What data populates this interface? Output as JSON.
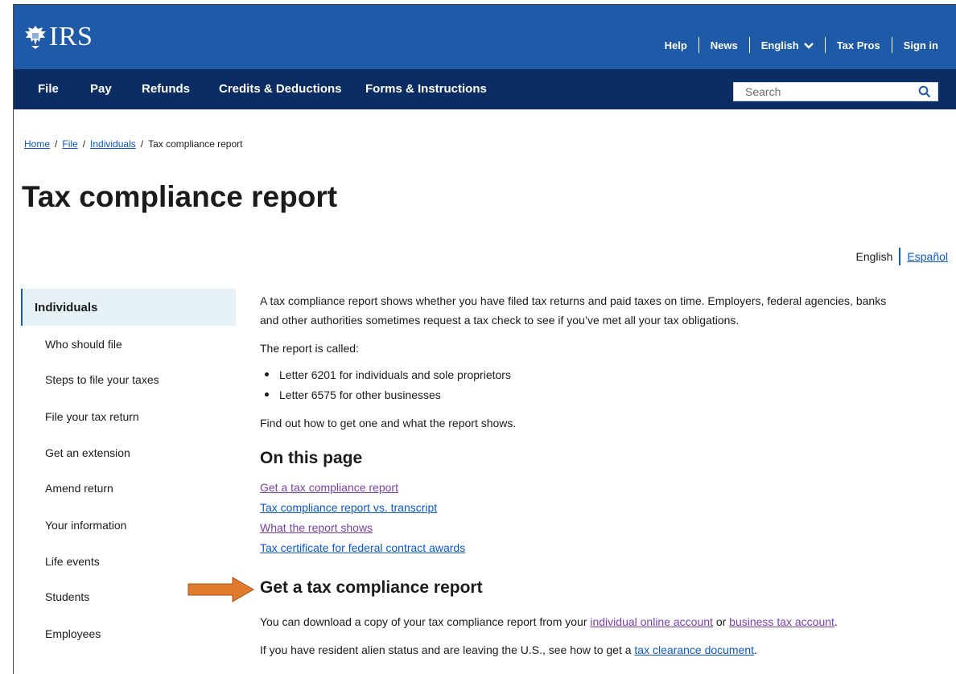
{
  "header": {
    "logo_text": "IRS",
    "utility_links": [
      "Help",
      "News",
      "English",
      "Tax Pros",
      "Sign in"
    ]
  },
  "nav": {
    "items": [
      "File",
      "Pay",
      "Refunds",
      "Credits & Deductions",
      "Forms & Instructions"
    ],
    "search_placeholder": "Search"
  },
  "breadcrumb": {
    "items": [
      "Home",
      "File",
      "Individuals"
    ],
    "current": "Tax compliance report"
  },
  "page": {
    "title": "Tax compliance report",
    "lang_current": "English",
    "lang_alt": "Español"
  },
  "sidebar": {
    "heading": "Individuals",
    "items": [
      "Who should file",
      "Steps to file your taxes",
      "File your tax return",
      "Get an extension",
      "Amend return",
      "Your information",
      "Life events",
      "Students",
      "Employees"
    ]
  },
  "content": {
    "intro_line1": "A tax compliance report shows whether you have filed tax returns and paid taxes on time. Employers, federal agencies, banks",
    "intro_line2": "and other authorities sometimes request a tax check to see if you’ve met all your tax obligations.",
    "called": "The report is called:",
    "bullets": [
      "Letter 6201 for individuals and sole proprietors",
      "Letter 6575 for other businesses"
    ],
    "find_out": "Find out how to get one and what the report shows.",
    "on_this_page": "On this page",
    "toc": [
      "Get a tax compliance report",
      "Tax compliance report vs. transcript",
      "What the report shows",
      "Tax certificate for federal contract awards"
    ],
    "get_heading": "Get a tax compliance report",
    "download_pre": "You can download a copy of your tax compliance report from your ",
    "download_link1": "individual online account",
    "download_or": " or ",
    "download_link2": "business tax account",
    "download_end": ".",
    "resident_pre": "If you have resident alien status and are leaving the U.S., see how to get a ",
    "resident_link": "tax clearance document",
    "resident_end": "."
  },
  "colors": {
    "topbar": "#1f5aa8",
    "navbar": "#0b2d64",
    "link": "#0b57d0",
    "visited": "#7a3fae",
    "arrow": "#e07b2e"
  }
}
